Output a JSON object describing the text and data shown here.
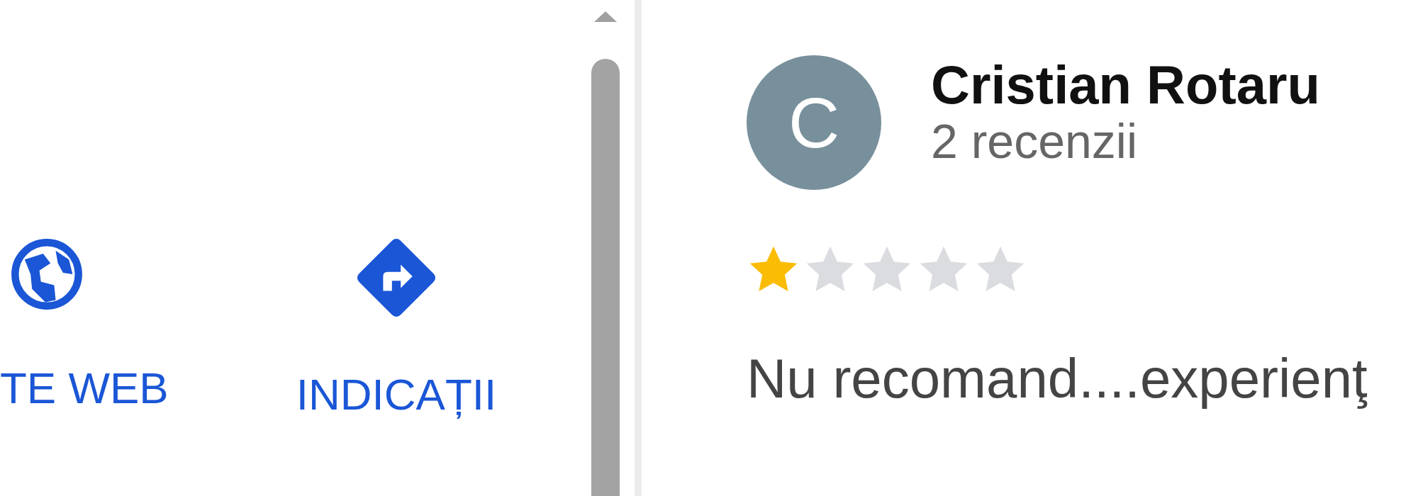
{
  "place_actions": [
    {
      "kind": "website",
      "label": "TE WEB"
    },
    {
      "kind": "directions",
      "label": "INDICAȚII"
    }
  ],
  "review": {
    "avatar_letter": "C",
    "author": "Cristian Rotaru",
    "review_count": "2 recenzii",
    "stars": 1,
    "text": "Nu recomand....experienţ"
  }
}
